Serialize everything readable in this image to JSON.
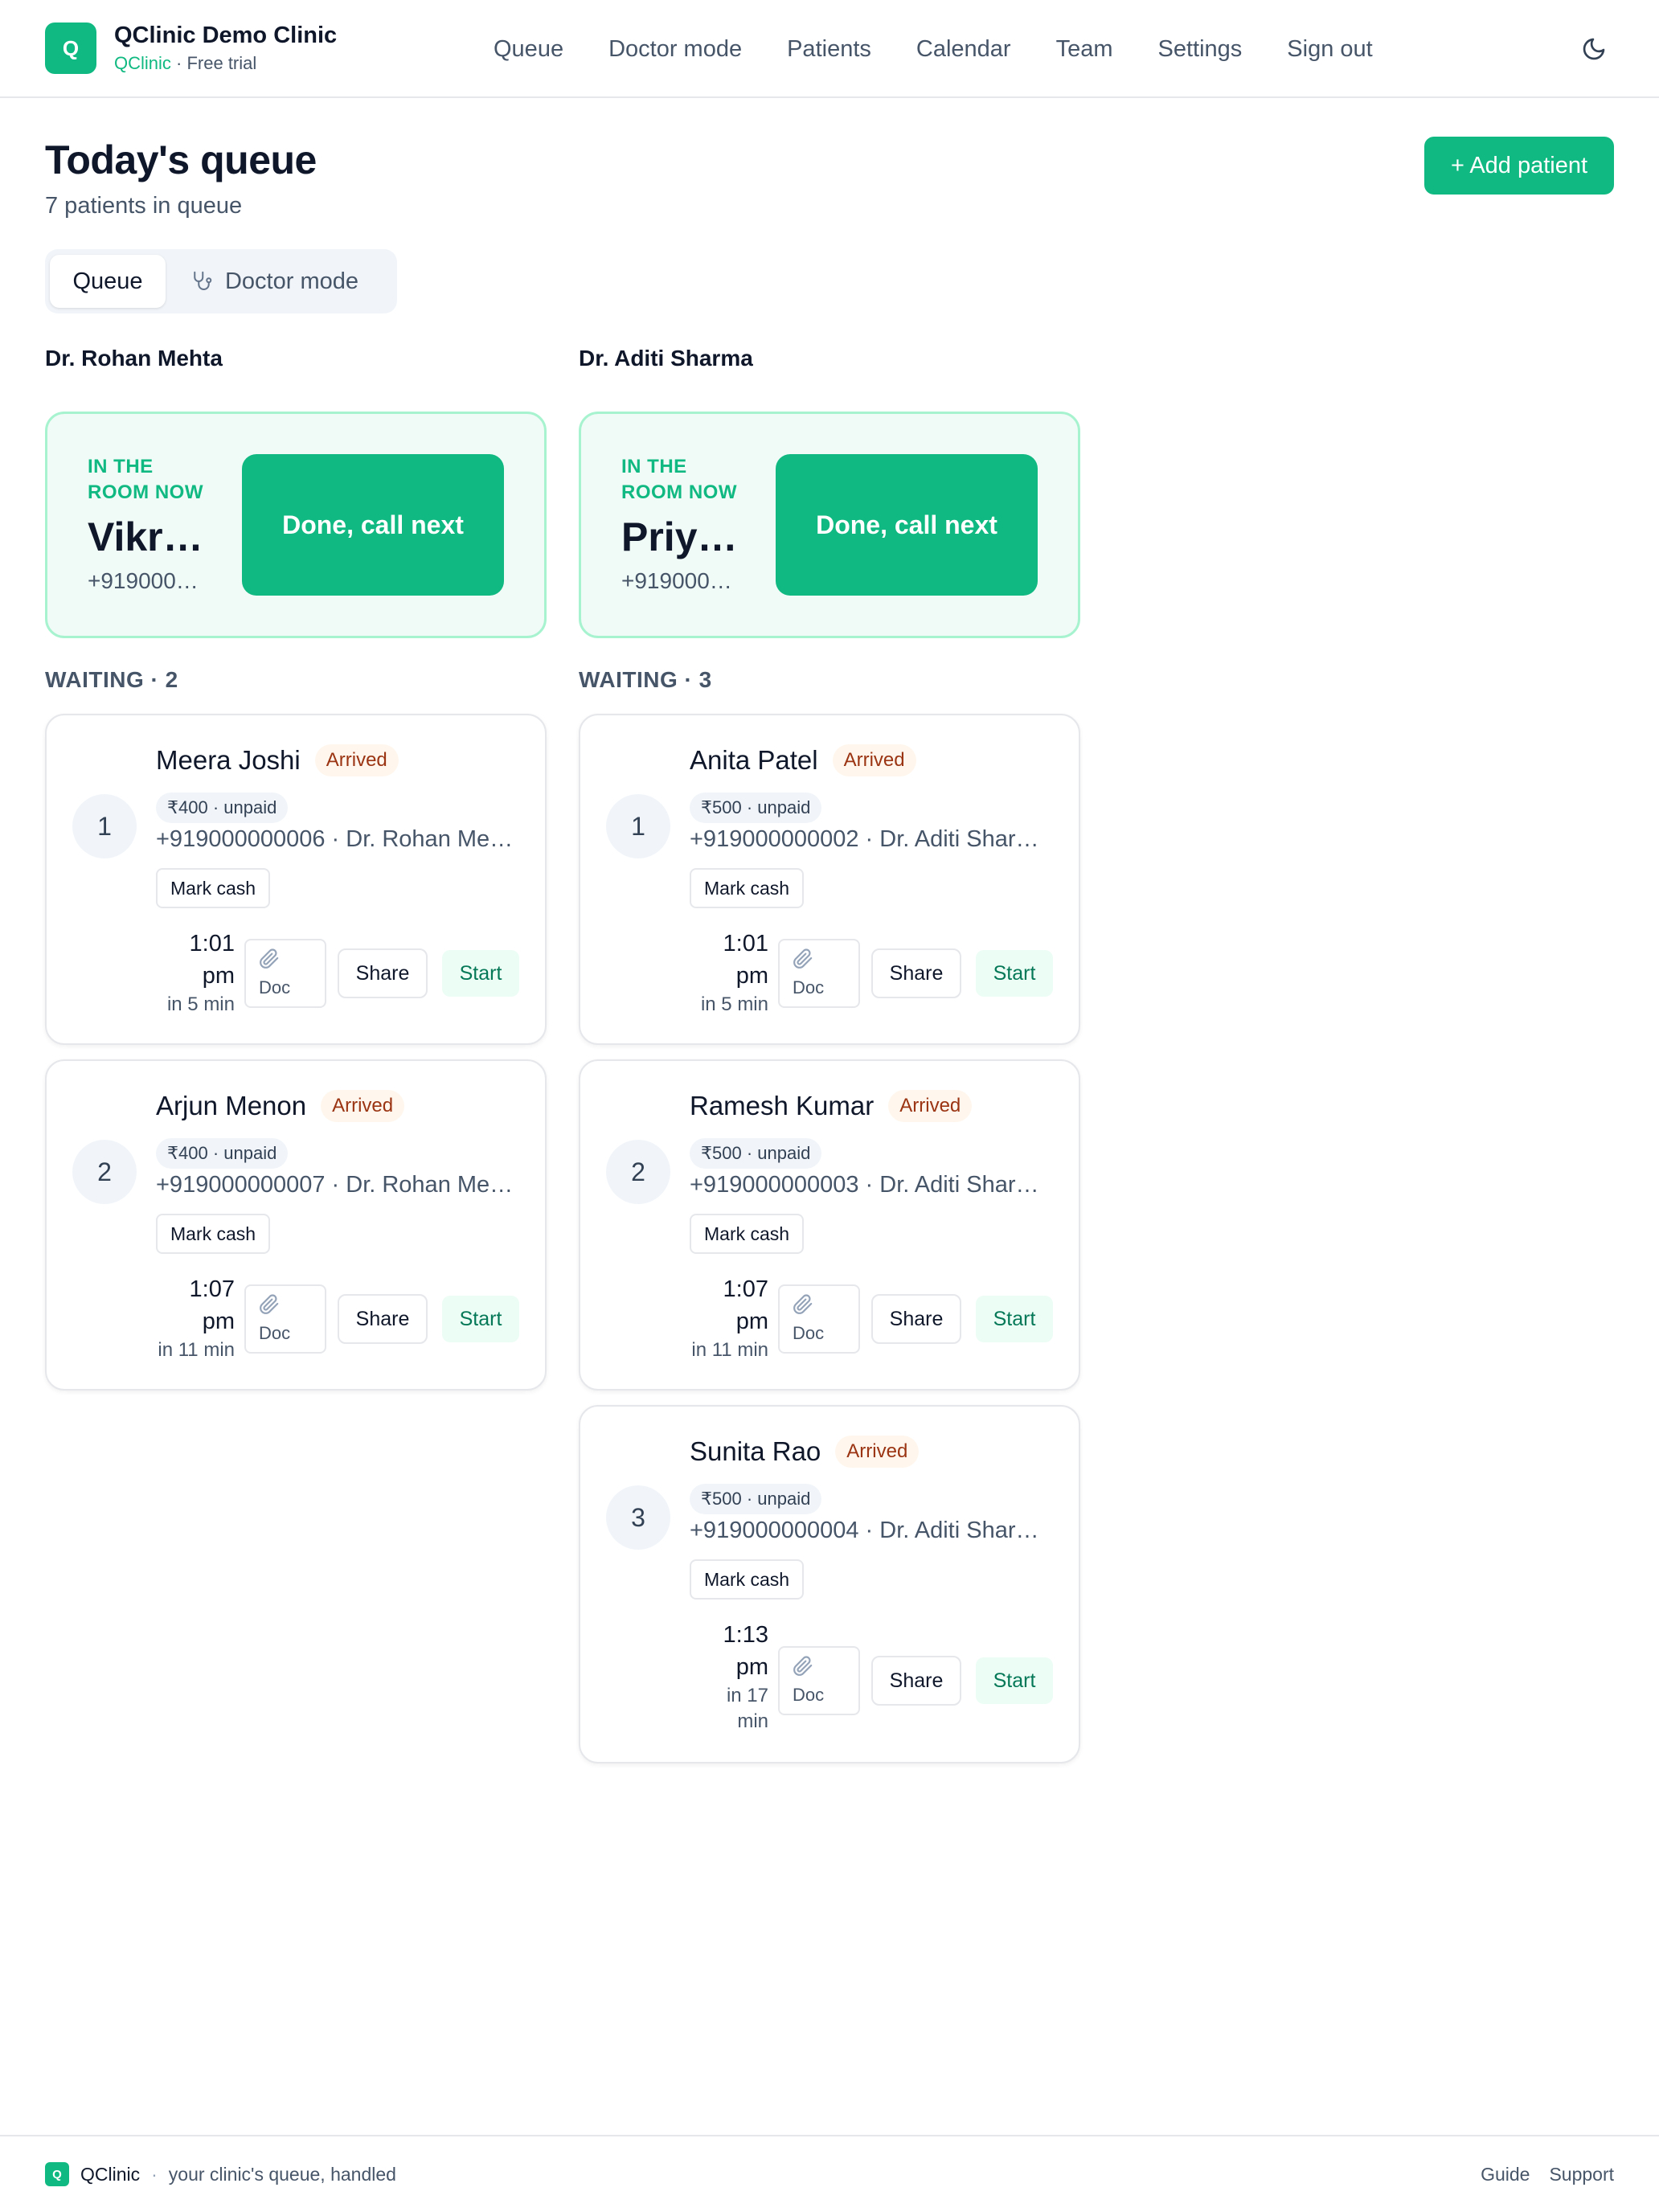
{
  "header": {
    "logo_letter": "Q",
    "clinic_name": "QClinic Demo Clinic",
    "product": "QClinic",
    "plan": "· Free trial",
    "nav": [
      "Queue",
      "Doctor mode",
      "Patients",
      "Calendar",
      "Team",
      "Settings",
      "Sign out"
    ],
    "theme_icon": "moon-icon"
  },
  "page": {
    "title": "Today's queue",
    "subtitle": "7 patients in queue",
    "add_button": "+ Add patient"
  },
  "view_toggle": {
    "queue": "Queue",
    "doctor_mode": "Doctor mode",
    "doctor_icon": "stethoscope-icon"
  },
  "columns": [
    {
      "doctor": "Dr. Rohan Mehta",
      "now": {
        "label": "IN THE ROOM NOW",
        "name": "Vikr…",
        "phone": "+919000…",
        "action": "Done, call next"
      },
      "waiting_label": "WAITING · 2",
      "patients": [
        {
          "position": "1",
          "name": "Meera Joshi",
          "status": "Arrived",
          "fee": "₹400 · unpaid",
          "meta": "+919000000006 · Dr. Rohan Me…",
          "mark_cash": "Mark cash",
          "time": "1:01 pm",
          "relative": "in 5 min",
          "doc": "Doc",
          "share": "Share",
          "start": "Start"
        },
        {
          "position": "2",
          "name": "Arjun Menon",
          "status": "Arrived",
          "fee": "₹400 · unpaid",
          "meta": "+919000000007 · Dr. Rohan Me…",
          "mark_cash": "Mark cash",
          "time": "1:07 pm",
          "relative": "in 11 min",
          "doc": "Doc",
          "share": "Share",
          "start": "Start"
        }
      ]
    },
    {
      "doctor": "Dr. Aditi Sharma",
      "now": {
        "label": "IN THE ROOM NOW",
        "name": "Priy…",
        "phone": "+919000…",
        "action": "Done, call next"
      },
      "waiting_label": "WAITING · 3",
      "patients": [
        {
          "position": "1",
          "name": "Anita Patel",
          "status": "Arrived",
          "fee": "₹500 · unpaid",
          "meta": "+919000000002 · Dr. Aditi Shar…",
          "mark_cash": "Mark cash",
          "time": "1:01 pm",
          "relative": "in 5 min",
          "doc": "Doc",
          "share": "Share",
          "start": "Start"
        },
        {
          "position": "2",
          "name": "Ramesh Kumar",
          "status": "Arrived",
          "fee": "₹500 · unpaid",
          "meta": "+919000000003 · Dr. Aditi Shar…",
          "mark_cash": "Mark cash",
          "time": "1:07 pm",
          "relative": "in 11 min",
          "doc": "Doc",
          "share": "Share",
          "start": "Start"
        },
        {
          "position": "3",
          "name": "Sunita Rao",
          "status": "Arrived",
          "fee": "₹500 · unpaid",
          "meta": "+919000000004 · Dr. Aditi Shar…",
          "mark_cash": "Mark cash",
          "time": "1:13 pm",
          "relative": "in 17 min",
          "doc": "Doc",
          "share": "Share",
          "start": "Start"
        }
      ]
    }
  ],
  "footer": {
    "logo_letter": "Q",
    "brand": "QClinic",
    "separator": "·",
    "tagline": "your clinic's queue, handled",
    "links": [
      "Guide",
      "Support"
    ]
  },
  "colors": {
    "accent": "#10b981",
    "now_bg": "#f0faf6",
    "arrived_text": "#9a3412",
    "arrived_bg": "#fff7ed"
  }
}
